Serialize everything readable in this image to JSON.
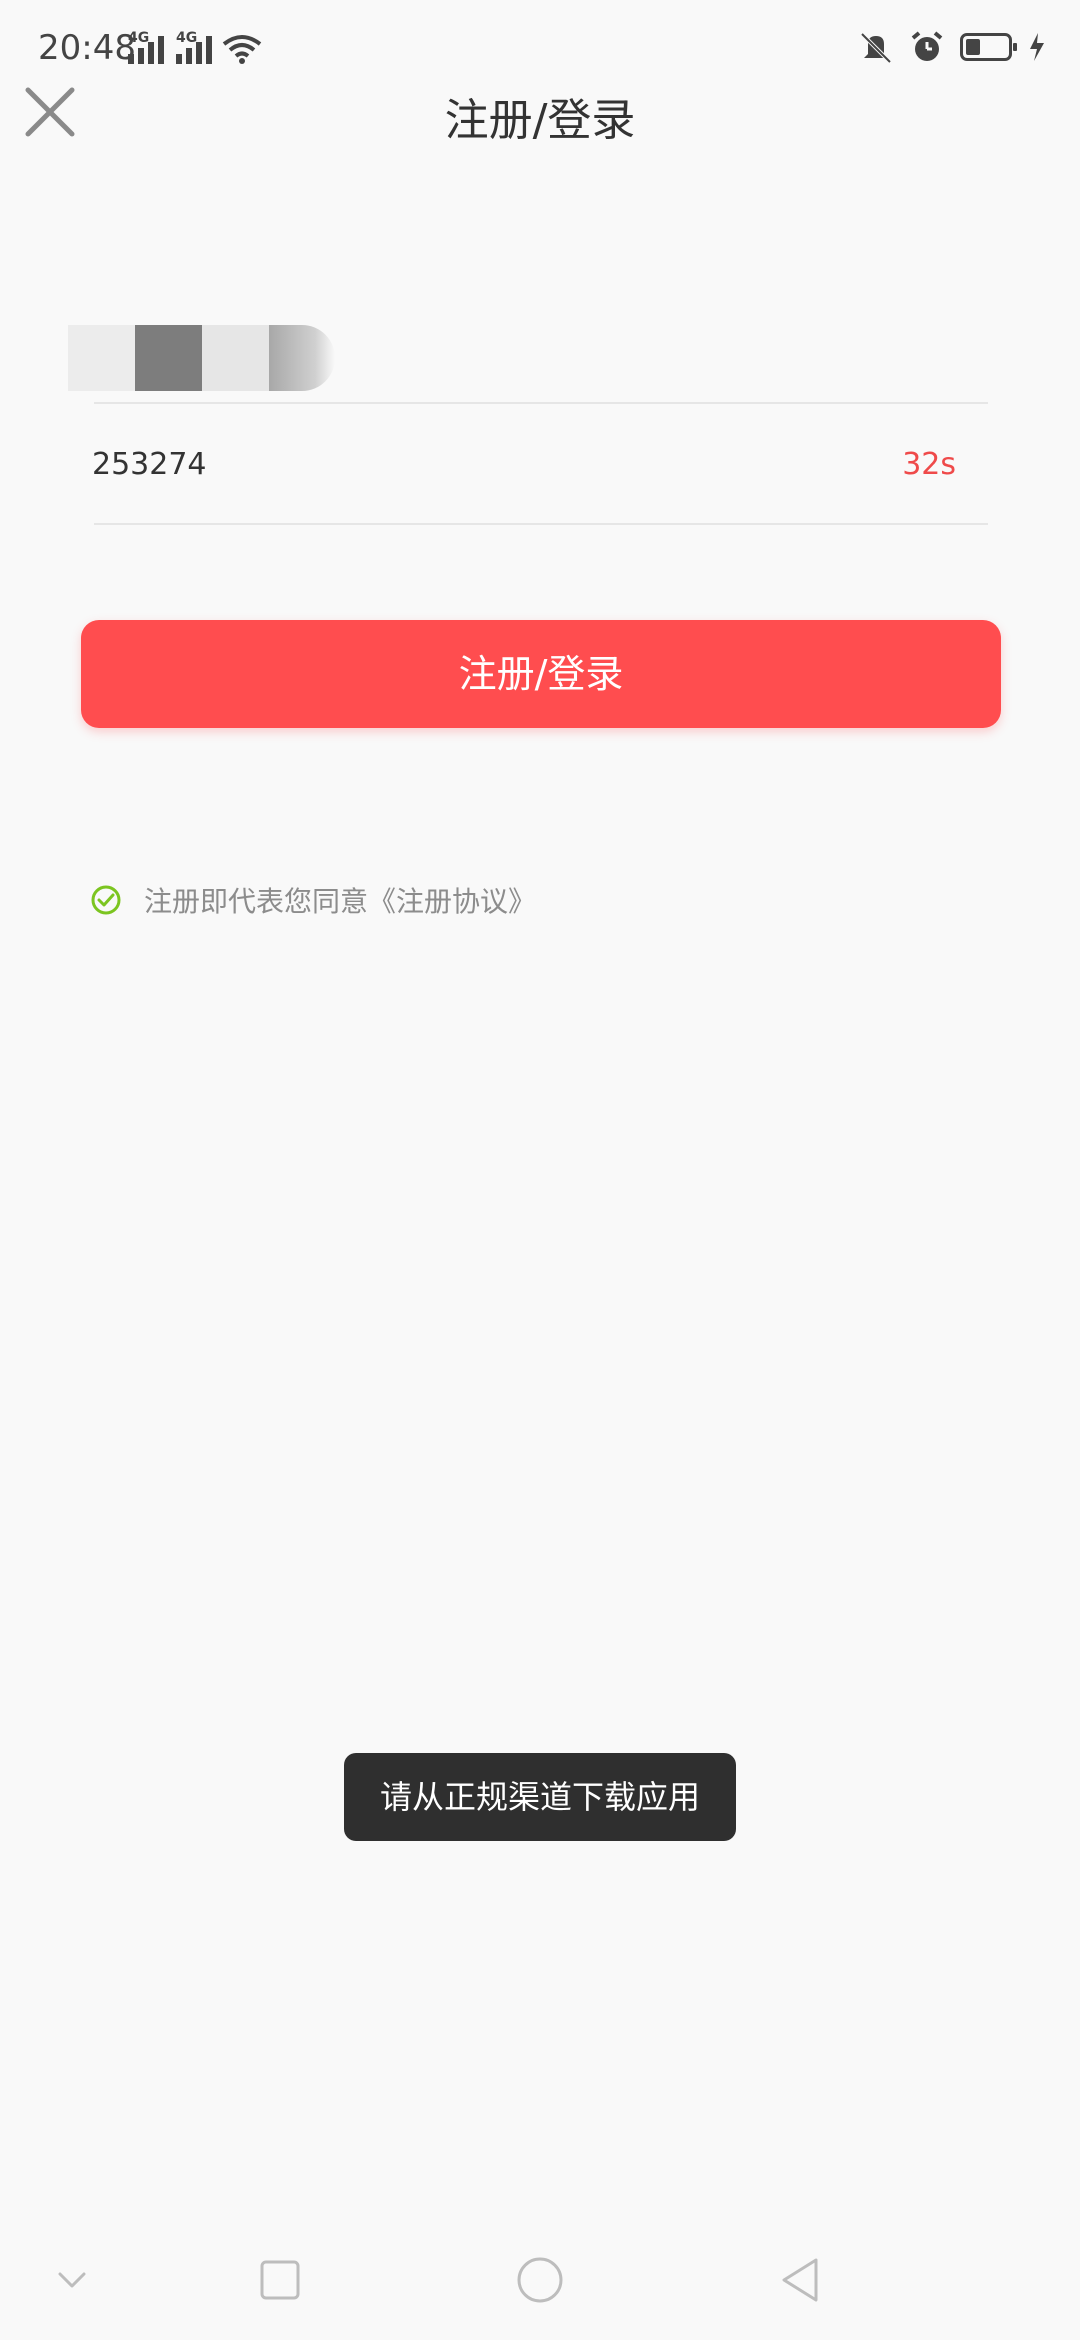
{
  "status_bar": {
    "time": "20:48",
    "network_tags": [
      "4G",
      "4G"
    ],
    "icons": [
      "signal-icon",
      "signal-icon",
      "wifi-icon",
      "mute-icon",
      "alarm-icon",
      "battery-icon",
      "charging-icon"
    ]
  },
  "header": {
    "title": "注册/登录",
    "close_icon": "close-icon"
  },
  "form": {
    "phone_value_masked": "",
    "verification_code_value": "253274",
    "countdown_label": "32s",
    "submit_label": "注册/登录"
  },
  "agreement": {
    "text": "注册即代表您同意《注册协议》",
    "check_icon": "check-circle-icon",
    "accent_color": "#7cc520"
  },
  "toast": {
    "message": "请从正规渠道下载应用"
  },
  "nav_bar": {
    "icons": [
      "chevron-down-icon",
      "square-icon",
      "circle-icon",
      "back-triangle-icon"
    ]
  },
  "colors": {
    "primary": "#ff4d4f",
    "countdown": "#ef4a4a",
    "background": "#f9f9f9"
  }
}
